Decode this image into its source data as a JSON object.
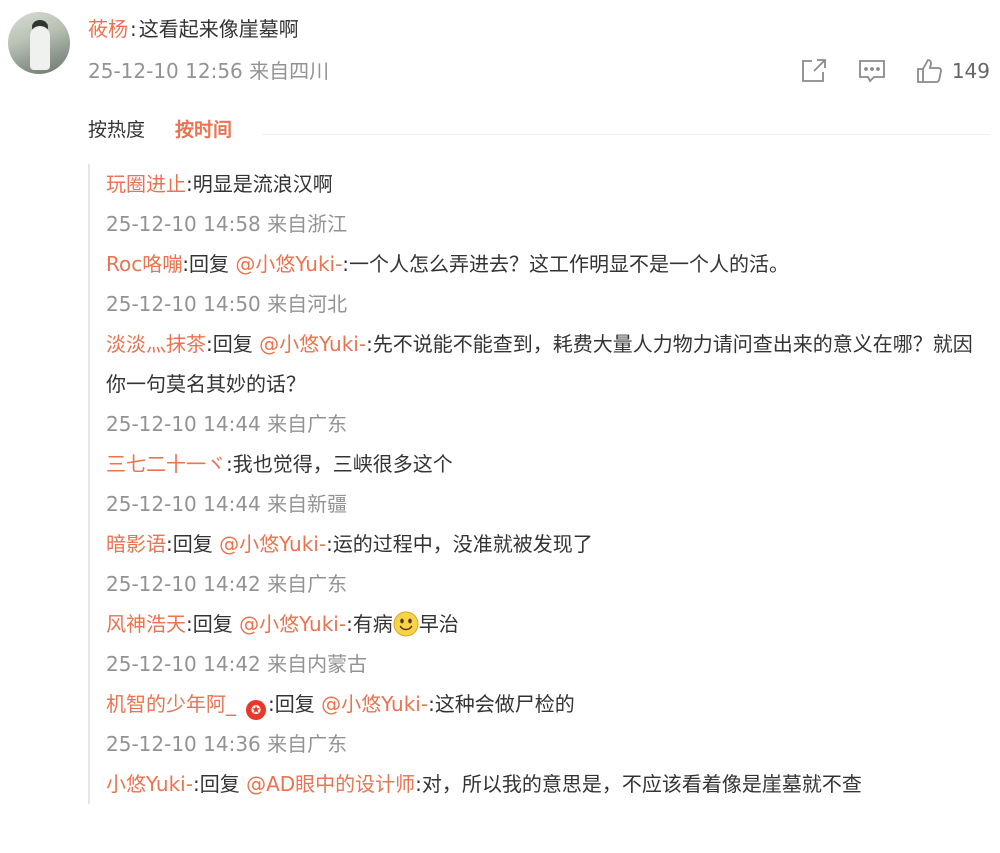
{
  "post": {
    "user": "莜杨",
    "separator": ":",
    "text": "这看起来像崖墓啊",
    "time": "25-12-10 12:56",
    "location": "来自四川",
    "like_count": "149"
  },
  "sort": {
    "hot_label": "按热度",
    "time_label": "按时间"
  },
  "replies": [
    {
      "user": "玩圈进止",
      "sep": ":",
      "prefix": "",
      "mention": "",
      "mention_sep": "",
      "text": "明显是流浪汉啊",
      "time": "25-12-10 14:58",
      "location": "来自浙江"
    },
    {
      "user": "Roc咯嘣",
      "sep": ":",
      "prefix": "回复",
      "mention": "@小悠Yuki-",
      "mention_sep": ":",
      "text": "一个人怎么弄进去？这工作明显不是一个人的活。",
      "time": "25-12-10 14:50",
      "location": "来自河北"
    },
    {
      "user": "淡淡灬抹茶",
      "sep": ":",
      "prefix": "回复",
      "mention": "@小悠Yuki-",
      "mention_sep": ":",
      "text": "先不说能不能查到，耗费大量人力物力请问查出来的意义在哪？就因你一句莫名其妙的话？",
      "time": "25-12-10 14:44",
      "location": "来自广东"
    },
    {
      "user": "三七二十一ヾ",
      "sep": ":",
      "prefix": "",
      "mention": "",
      "mention_sep": "",
      "text": "我也觉得，三峡很多这个",
      "time": "25-12-10 14:44",
      "location": "来自新疆"
    },
    {
      "user": "暗影语",
      "sep": ":",
      "prefix": "回复",
      "mention": "@小悠Yuki-",
      "mention_sep": ":",
      "text": "运的过程中，没准就被发现了",
      "time": "25-12-10 14:42",
      "location": "来自广东"
    },
    {
      "user": "风神浩天",
      "sep": ":",
      "prefix": "回复",
      "mention": "@小悠Yuki-",
      "mention_sep": ":",
      "text": "有病",
      "text_after": "早治",
      "time": "25-12-10 14:42",
      "location": "来自内蒙古"
    },
    {
      "user": "机智的少年阿_",
      "sep": ":",
      "prefix": "回复",
      "mention": "@小悠Yuki-",
      "mention_sep": ":",
      "text": "这种会做尸检的",
      "time": "25-12-10 14:36",
      "location": "来自广东"
    },
    {
      "user": "小悠Yuki-",
      "sep": ":",
      "prefix": "回复",
      "mention": "@AD眼中的设计师",
      "mention_sep": ":",
      "text": "对，所以我的意思是，不应该看着像是崖墓就不查"
    }
  ],
  "icons": {
    "share": "share-icon",
    "comment": "comment-icon",
    "like": "thumbs-up-icon",
    "badge": "vip-badge-icon",
    "emoji": "smiley-emoji-icon"
  },
  "colors": {
    "accent": "#eb7350",
    "meta": "#939393"
  }
}
